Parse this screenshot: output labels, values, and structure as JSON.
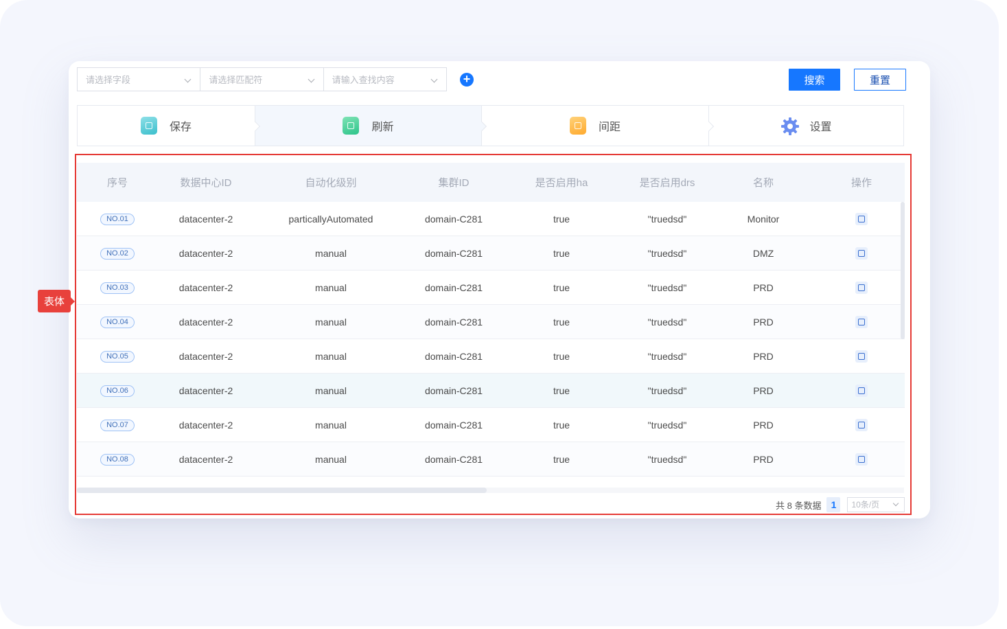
{
  "filters": {
    "field_placeholder": "请选择字段",
    "match_placeholder": "请选择匹配符",
    "content_placeholder": "请输入查找内容",
    "add_glyph": "+"
  },
  "actions": {
    "search_label": "搜索",
    "reset_label": "重置"
  },
  "toolbar": {
    "items": [
      {
        "label": "保存",
        "icon": "save-icon"
      },
      {
        "label": "刷新",
        "icon": "refresh-icon"
      },
      {
        "label": "间距",
        "icon": "spacing-icon"
      },
      {
        "label": "设置",
        "icon": "settings-icon"
      }
    ]
  },
  "table": {
    "columns": [
      "序号",
      "数据中心ID",
      "自动化级别",
      "集群ID",
      "是否启用ha",
      "是否启用drs",
      "名称",
      "操作"
    ],
    "rows": [
      {
        "no": "NO.01",
        "datacenter": "datacenter-2",
        "level": "particallyAutomated",
        "cluster": "domain-C281",
        "ha": "true",
        "drs": "\"truedsd\"",
        "name": "Monitor"
      },
      {
        "no": "NO.02",
        "datacenter": "datacenter-2",
        "level": "manual",
        "cluster": "domain-C281",
        "ha": "true",
        "drs": "\"truedsd\"",
        "name": "DMZ"
      },
      {
        "no": "NO.03",
        "datacenter": "datacenter-2",
        "level": "manual",
        "cluster": "domain-C281",
        "ha": "true",
        "drs": "\"truedsd\"",
        "name": "PRD"
      },
      {
        "no": "NO.04",
        "datacenter": "datacenter-2",
        "level": "manual",
        "cluster": "domain-C281",
        "ha": "true",
        "drs": "\"truedsd\"",
        "name": "PRD"
      },
      {
        "no": "NO.05",
        "datacenter": "datacenter-2",
        "level": "manual",
        "cluster": "domain-C281",
        "ha": "true",
        "drs": "\"truedsd\"",
        "name": "PRD"
      },
      {
        "no": "NO.06",
        "datacenter": "datacenter-2",
        "level": "manual",
        "cluster": "domain-C281",
        "ha": "true",
        "drs": "\"truedsd\"",
        "name": "PRD"
      },
      {
        "no": "NO.07",
        "datacenter": "datacenter-2",
        "level": "manual",
        "cluster": "domain-C281",
        "ha": "true",
        "drs": "\"truedsd\"",
        "name": "PRD"
      },
      {
        "no": "NO.08",
        "datacenter": "datacenter-2",
        "level": "manual",
        "cluster": "domain-C281",
        "ha": "true",
        "drs": "\"truedsd\"",
        "name": "PRD"
      }
    ],
    "row_action_icon": "view-icon"
  },
  "pagination": {
    "total_text": "共 8 条数据",
    "current_page": "1",
    "page_size": "10条/页"
  },
  "annotation": {
    "label": "表体",
    "color": "#e53935"
  },
  "colors": {
    "primary": "#1677ff",
    "header_bg": "#f3f6fb"
  }
}
